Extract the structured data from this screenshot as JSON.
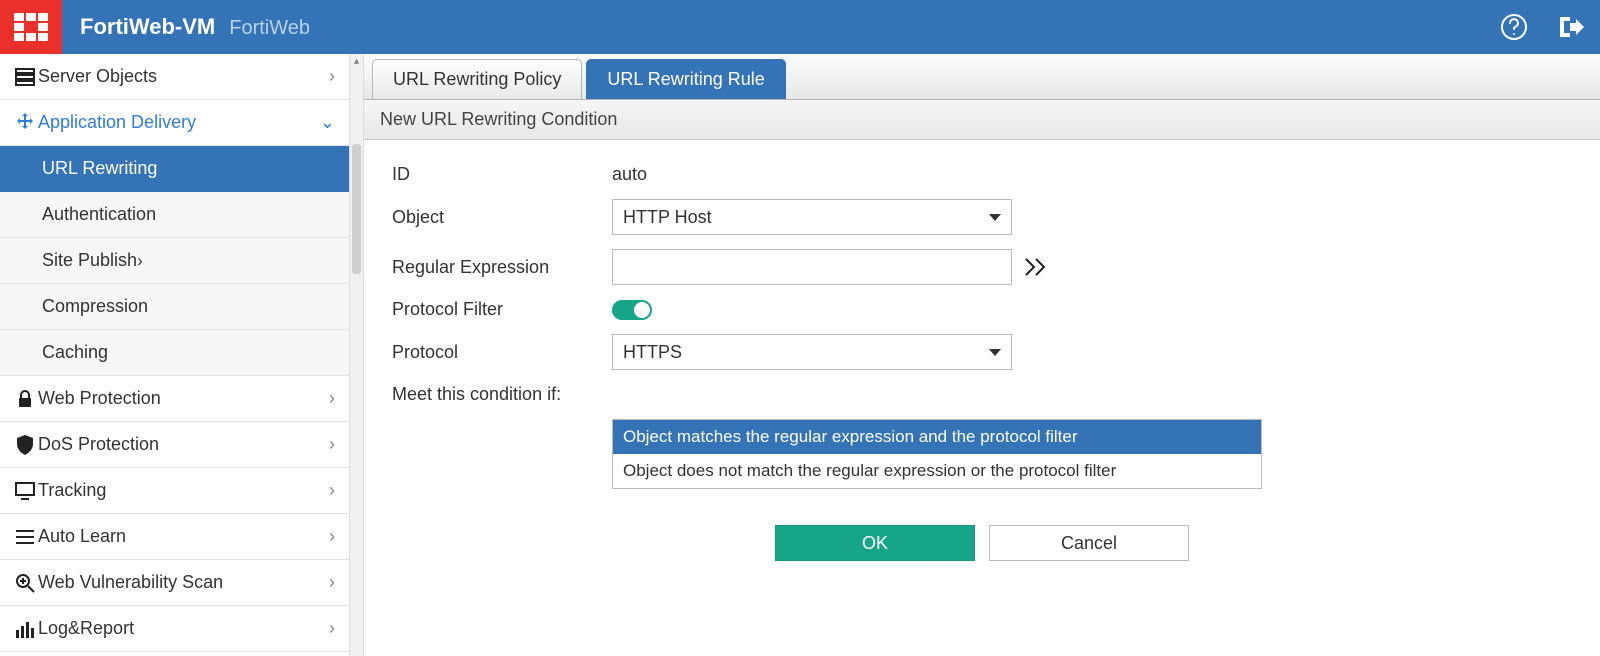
{
  "header": {
    "product": "FortiWeb-VM",
    "subtitle": "FortiWeb"
  },
  "sidebar": {
    "items": [
      {
        "label": "Server Objects"
      },
      {
        "label": "Application Delivery"
      },
      {
        "label": "Web Protection"
      },
      {
        "label": "DoS Protection"
      },
      {
        "label": "Tracking"
      },
      {
        "label": "Auto Learn"
      },
      {
        "label": "Web Vulnerability Scan"
      },
      {
        "label": "Log&Report"
      }
    ],
    "app_delivery_children": [
      {
        "label": "URL Rewriting"
      },
      {
        "label": "Authentication"
      },
      {
        "label": "Site Publish"
      },
      {
        "label": "Compression"
      },
      {
        "label": "Caching"
      }
    ]
  },
  "tabs": {
    "policy": "URL Rewriting Policy",
    "rule": "URL Rewriting Rule"
  },
  "section": "New URL Rewriting Condition",
  "form": {
    "id_label": "ID",
    "id_value": "auto",
    "object_label": "Object",
    "object_value": "HTTP Host",
    "regex_label": "Regular Expression",
    "regex_value": "",
    "protofilter_label": "Protocol Filter",
    "protocol_label": "Protocol",
    "protocol_value": "HTTPS",
    "meet_label": "Meet this condition if:",
    "condition_options": [
      "Object matches the regular expression and the protocol filter",
      "Object does not match the regular expression or the protocol filter"
    ]
  },
  "buttons": {
    "ok": "OK",
    "cancel": "Cancel"
  }
}
